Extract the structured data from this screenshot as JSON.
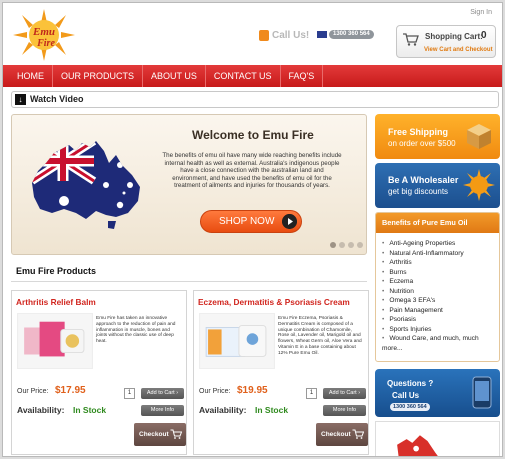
{
  "header": {
    "signin": "Sign In",
    "call_label": "Call Us!",
    "phone": "1300 360 564",
    "cart_title": "Shopping Cart:",
    "cart_count": "0",
    "cart_link": "View Cart and Checkout"
  },
  "nav": [
    "HOME",
    "OUR PRODUCTS",
    "ABOUT US",
    "CONTACT US",
    "FAQ'S"
  ],
  "video": {
    "label": "Watch Video"
  },
  "hero": {
    "title": "Welcome to Emu Fire",
    "text": "The benefits of emu oil have many wide reaching benefits include internal health as well as external. Australia's indigenous people have a close connection with the australian land and environment, and have used the benefits of emu oil for the treatment of ailments and injuries for thousands of years.",
    "button": "SHOP NOW"
  },
  "products": {
    "title": "Emu Fire Products",
    "items": [
      {
        "name": "Arthritis Relief Balm",
        "desc": "Emu Fire has taken an innovative approach to the reduction of pain and inflammation in muscle, bones and joints without the classic use of deep heat.",
        "price_label": "Our Price:",
        "price": "$17.95",
        "qty": "1",
        "add": "Add to Cart",
        "more": "More Info",
        "avail_label": "Availability:",
        "avail": "In Stock",
        "checkout": "Checkout"
      },
      {
        "name": "Eczema, Dermatitis & Psoriasis Cream",
        "desc": "Emu Fire Eczema, Psoriasis & Dermatitis Cream is composed of a unique combination of Chamomile, Rose oil, Lavender oil, Marigold oil and flowers, Wheat Germ oil, Aloe Vera and Vitamin E in a base containing about 12% Pure Emu Oil.",
        "price_label": "Our Price:",
        "price": "$19.95",
        "qty": "1",
        "add": "Add to Cart",
        "more": "More Info",
        "avail_label": "Availability:",
        "avail": "In Stock",
        "checkout": "Checkout"
      }
    ]
  },
  "sidebar": {
    "shipping_title": "Free Shipping",
    "shipping_sub": "on order over $500",
    "wholesale_title": "Be A Wholesaler",
    "wholesale_sub": "get big discounts",
    "benefits_title": "Benefits of Pure Emu Oil",
    "benefits": [
      "Anti-Ageing Properties",
      "Natural Anti-Inflammatory",
      "Arthritis",
      "Burns",
      "Eczema",
      "Nutrition",
      "Omega 3 EFA's",
      "Pain Management",
      "Psoriasis",
      "Sports Injuries",
      "Wound Care, and much, much more..."
    ],
    "questions_title": "Questions ?",
    "questions_call": "Call Us",
    "questions_phone": "1300 360 564"
  },
  "colors": {
    "nav_red": "#d42727",
    "price_orange": "#e0601b",
    "stock_green": "#2f8a1e",
    "title_red": "#d1261f"
  }
}
